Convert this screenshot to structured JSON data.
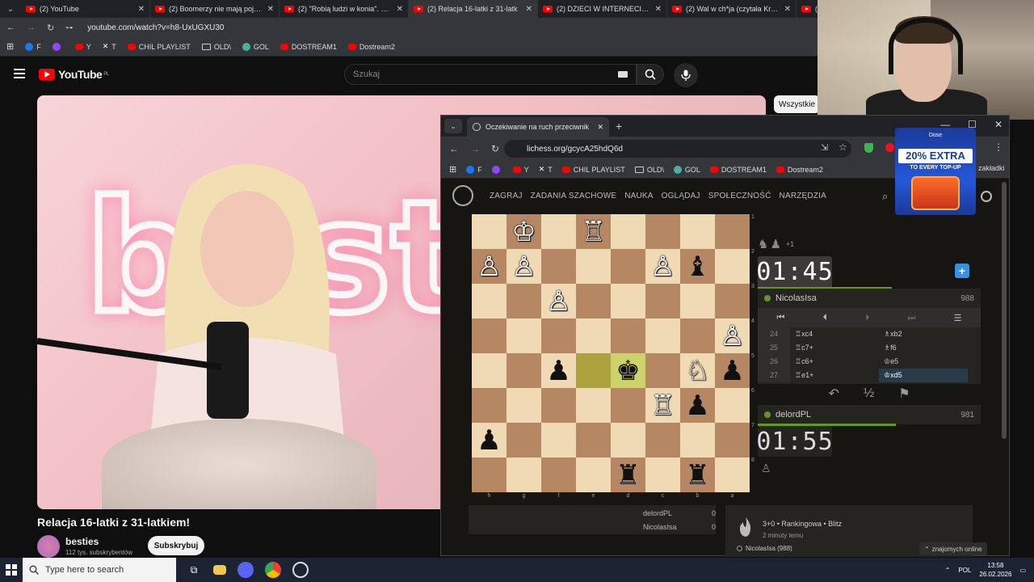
{
  "outer_tabs": [
    {
      "title": "(2) YouTube",
      "active": false
    },
    {
      "title": "(2) Boomerzy nie mają pojęcia",
      "active": false
    },
    {
      "title": "(2) \"Robią ludzi w konia\". Szara",
      "active": false
    },
    {
      "title": "(2) Relacja 16-latki z 31-latk",
      "active": true
    },
    {
      "title": "(2) DZIECI W INTERNECIE: GDZ",
      "active": false
    },
    {
      "title": "(2) Wal w ch*ja (czytała Krystyn",
      "active": false
    },
    {
      "title": "(2)",
      "active": false
    }
  ],
  "outer_url": "youtube.com/watch?v=h8-UxUGXU30",
  "bookmarks": [
    {
      "label": "F",
      "icon": "facebook-icon",
      "color": "#1877f2"
    },
    {
      "label": "",
      "icon": "twitch-icon",
      "color": "#9146ff"
    },
    {
      "label": "Y",
      "icon": "youtube-icon",
      "color": "#ff0000"
    },
    {
      "label": "T",
      "icon": "x-icon",
      "color": "#ffffff"
    },
    {
      "label": "CHIL PLAYLIST",
      "icon": "youtube-icon",
      "color": "#ff0000"
    },
    {
      "label": "OLD\\",
      "icon": "folder-icon",
      "color": "#cccccc"
    },
    {
      "label": "GOL",
      "icon": "gol-icon",
      "color": "#4ab0a0"
    },
    {
      "label": "DOSTREAM1",
      "icon": "youtube-icon",
      "color": "#ff0000"
    },
    {
      "label": "Dostream2",
      "icon": "youtube-icon",
      "color": "#ff0000"
    }
  ],
  "youtube": {
    "logo": "YouTube",
    "logo_country": "PL",
    "search_placeholder": "Szukaj",
    "video_title": "Relacja 16-latki z 31-latkiem!",
    "channel_name": "besties",
    "channel_subs": "112 tys. subskrybentów",
    "subscribe_label": "Subskrybuj",
    "chip_label": "Wszystkie",
    "neon_text": "best"
  },
  "inner_window": {
    "tab_title": "Oczekiwanie na ruch przeciwnik",
    "url": "lichess.org/gcycA25hdQ6d",
    "bookmarks_right": "zakładki"
  },
  "lichess": {
    "nav": [
      "ZAGRAJ",
      "ZADANIA SZACHOWE",
      "NAUKA",
      "OGLĄDAJ",
      "SPOŁECZNOŚĆ",
      "NARZĘDZIA"
    ],
    "board": [
      [
        "",
        "♔",
        "",
        "♖",
        "",
        "",
        "",
        ""
      ],
      [
        "♙",
        "♙",
        "",
        "",
        "",
        "♙",
        "♝",
        ""
      ],
      [
        "",
        "",
        "♙",
        "",
        "",
        "",
        "",
        ""
      ],
      [
        "",
        "",
        "",
        "",
        "",
        "",
        "",
        "♙"
      ],
      [
        "",
        "",
        "♟",
        "",
        "♚",
        "",
        "♘",
        "♟"
      ],
      [
        "",
        "",
        "",
        "",
        "",
        "♖",
        "♟",
        ""
      ],
      [
        "♟",
        "",
        "",
        "",
        "",
        "",
        "",
        ""
      ],
      [
        "",
        "",
        "",
        "",
        "♜",
        "",
        "♜",
        ""
      ]
    ],
    "files": [
      "h",
      "g",
      "f",
      "e",
      "d",
      "c",
      "b",
      "a"
    ],
    "ranks": [
      "1",
      "2",
      "3",
      "4",
      "5",
      "6",
      "7",
      "8"
    ],
    "top_clock": "01:45",
    "bottom_clock": "01:55",
    "top_time_fraction": 0.6,
    "bottom_time_fraction": 0.62,
    "top_player": {
      "name": "NicolasIsa",
      "rating": "988"
    },
    "bottom_player": {
      "name": "delordPL",
      "rating": "981"
    },
    "captured_extra": "+1",
    "moves": [
      {
        "n": "24",
        "w": "♖xc4",
        "b": "♗xb2"
      },
      {
        "n": "25",
        "w": "♖c7+",
        "b": "♗f6"
      },
      {
        "n": "26",
        "w": "♖c6+",
        "b": "♔e5"
      },
      {
        "n": "27",
        "w": "♖e1+",
        "b": "♔xd5"
      }
    ],
    "crosstable": [
      {
        "name": "delordPL",
        "score": "0"
      },
      {
        "name": "NicolasIsa",
        "score": "0"
      }
    ],
    "game_type": "3+0 • Rankingowa • Blitz",
    "game_time": "2 minuty temu",
    "game_player": "NicolasIsa (988)",
    "friends_online": "znajomych online",
    "draw_symbol": "½"
  },
  "ad": {
    "brand": "Dose",
    "headline": "20% EXTRA",
    "sub": "TO EVERY TOP-UP"
  },
  "taskbar": {
    "search_placeholder": "Type here to search",
    "lang": "POL",
    "time": "13:58",
    "date": "26.02.2026"
  }
}
